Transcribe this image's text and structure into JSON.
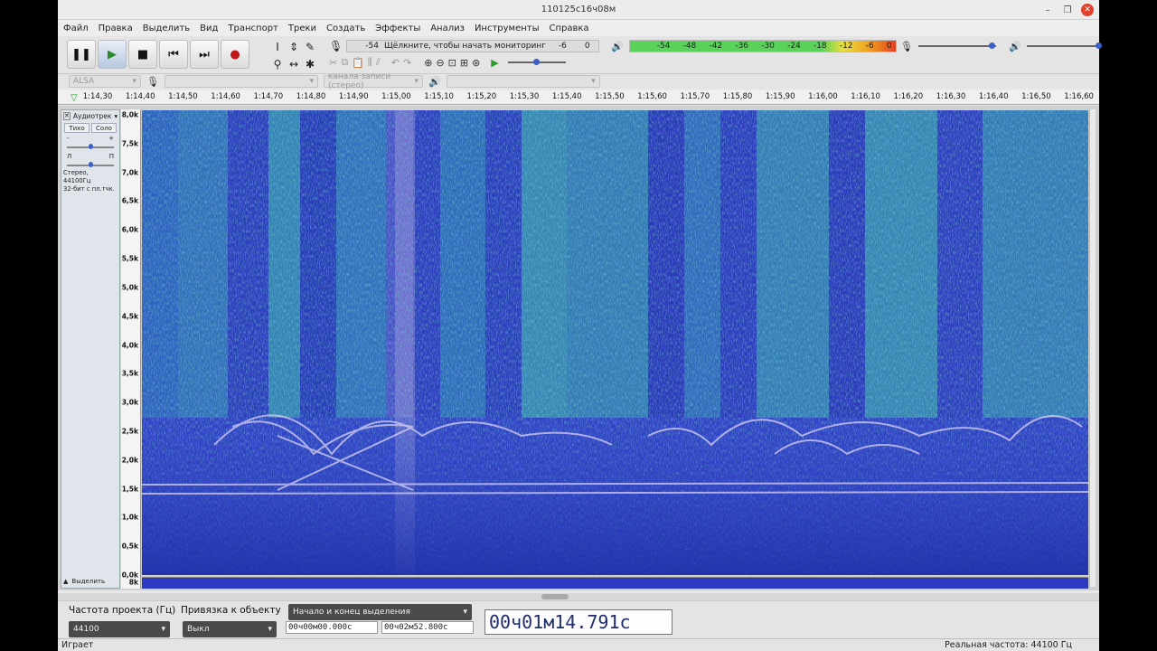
{
  "window": {
    "title": "110125c16ч08м"
  },
  "menu": [
    "Файл",
    "Правка",
    "Выделить",
    "Вид",
    "Транспорт",
    "Треки",
    "Создать",
    "Эффекты",
    "Анализ",
    "Инструменты",
    "Справка"
  ],
  "meters": {
    "rec_prefix": "Л\nП",
    "rec_db": "-54",
    "rec_text": "Щёлкните, чтобы начать мониторинг",
    "rec_db2": "-6",
    "rec_db3": "0",
    "play_prefix": "Л\nП",
    "play_scale": [
      "-54",
      "-48",
      "-42",
      "-36",
      "-30",
      "-24",
      "-18",
      "-12",
      "-6",
      "0"
    ]
  },
  "devices": {
    "host": "ALSA",
    "channels": "канала записи (стерео)"
  },
  "ruler": {
    "ticks": [
      "1:14,30",
      "1:14,40",
      "1:14,50",
      "1:14,60",
      "1:14,70",
      "1:14,80",
      "1:14,90",
      "1:15,00",
      "1:15,10",
      "1:15,20",
      "1:15,30",
      "1:15,40",
      "1:15,50",
      "1:15,60",
      "1:15,70",
      "1:15,80",
      "1:15,90",
      "1:16,00",
      "1:16,10",
      "1:16,20",
      "1:16,30",
      "1:16,40",
      "1:16,50",
      "1:16,60"
    ]
  },
  "track": {
    "name": "Аудиотрек",
    "mute": "Тихо",
    "solo": "Соло",
    "gain_min": "-",
    "gain_max": "+",
    "pan_l": "Л",
    "pan_r": "П",
    "info1": "Стерео, 44100Гц",
    "info2": "32-бит с пл.тчк.",
    "select": "Выделить",
    "freq_labels": [
      "8,0k",
      "7,5k",
      "7,0k",
      "6,5k",
      "6,0k",
      "5,5k",
      "5,0k",
      "4,5k",
      "4,0k",
      "3,5k",
      "3,0k",
      "2,5k",
      "2,0k",
      "1,5k",
      "1,0k",
      "0,5k",
      "0,0k"
    ],
    "bottom_label": "8k"
  },
  "selection_toolbar": {
    "rate_label": "Частота проекта (Гц)",
    "rate_value": "44100",
    "snap_label": "Привязка к объекту",
    "snap_value": "Выкл",
    "mode": "Начало и конец выделения",
    "start": "00ч00м00.000с",
    "end": "00ч02м52.800с",
    "position": "00ч01м14.791с"
  },
  "status": {
    "left": "Играет",
    "right": "Реальная частота: 44100 Гц"
  }
}
